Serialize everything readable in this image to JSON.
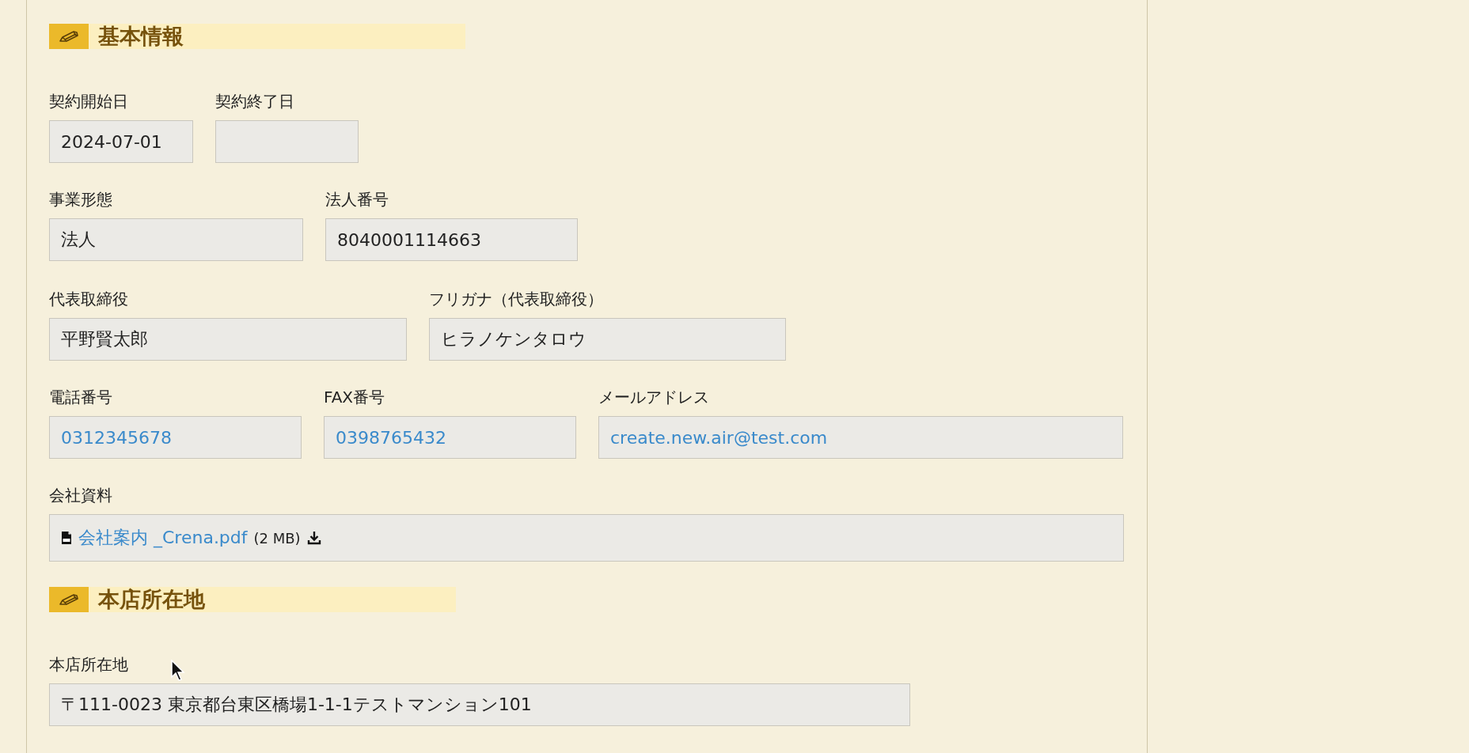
{
  "sections": [
    {
      "title": "基本情報",
      "rows": [
        [
          {
            "label": "契約開始日",
            "kind": "text",
            "value": "2024-07-01"
          },
          {
            "label": "契約終了日",
            "kind": "text"
          }
        ],
        [
          {
            "label": "事業形態",
            "kind": "text",
            "value": "法人"
          },
          {
            "label": "法人番号",
            "kind": "text",
            "value": "8040001114663"
          }
        ],
        [
          {
            "label": "代表取締役",
            "kind": "text",
            "value": "平野賢太郎"
          },
          {
            "label": "フリガナ（代表取締役）",
            "kind": "text",
            "value": "ヒラノケンタロウ"
          }
        ],
        [
          {
            "label": "電話番号",
            "kind": "link",
            "value": "0312345678"
          },
          {
            "label": "FAX番号",
            "kind": "link",
            "value": "0398765432"
          },
          {
            "label": "メールアドレス",
            "kind": "link",
            "value": "create.new.air@test.com"
          }
        ],
        [
          {
            "label": "会社資料",
            "kind": "file",
            "file_name": "会社案内 _Crena.pdf",
            "file_size": "(2 MB)"
          }
        ]
      ]
    },
    {
      "title": "本店所在地",
      "rows": [
        [
          {
            "label": "本店所在地",
            "kind": "text",
            "value": "〒111-0023 東京都台東区橋場1-1-1テストマンション101"
          }
        ]
      ]
    }
  ]
}
